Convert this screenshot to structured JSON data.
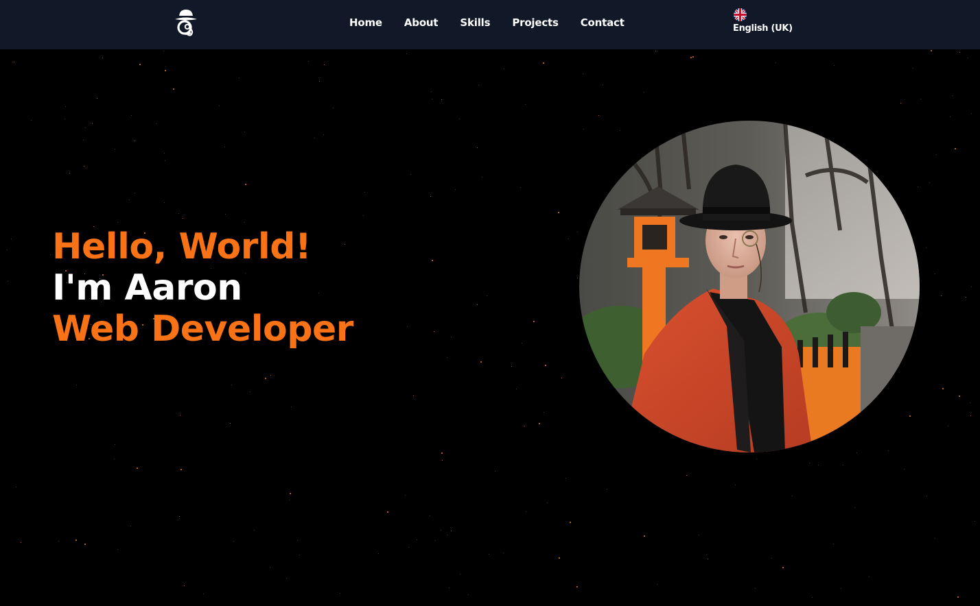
{
  "header": {
    "logo_icon": "bowler-hat-monocle-logo-icon",
    "nav": [
      {
        "label": "Home"
      },
      {
        "label": "About"
      },
      {
        "label": "Skills"
      },
      {
        "label": "Projects"
      },
      {
        "label": "Contact"
      }
    ],
    "language": {
      "flag_icon": "uk-flag-icon",
      "label": "English (UK)"
    }
  },
  "hero": {
    "greeting": "Hello, World!",
    "intro": "I'm Aaron",
    "role": "Web Developer"
  },
  "portrait": {
    "description_icon": "profile-photo"
  },
  "colors": {
    "accent": "#f97316",
    "nav_background": "#111827",
    "page_background": "#000000",
    "text": "#ffffff"
  }
}
